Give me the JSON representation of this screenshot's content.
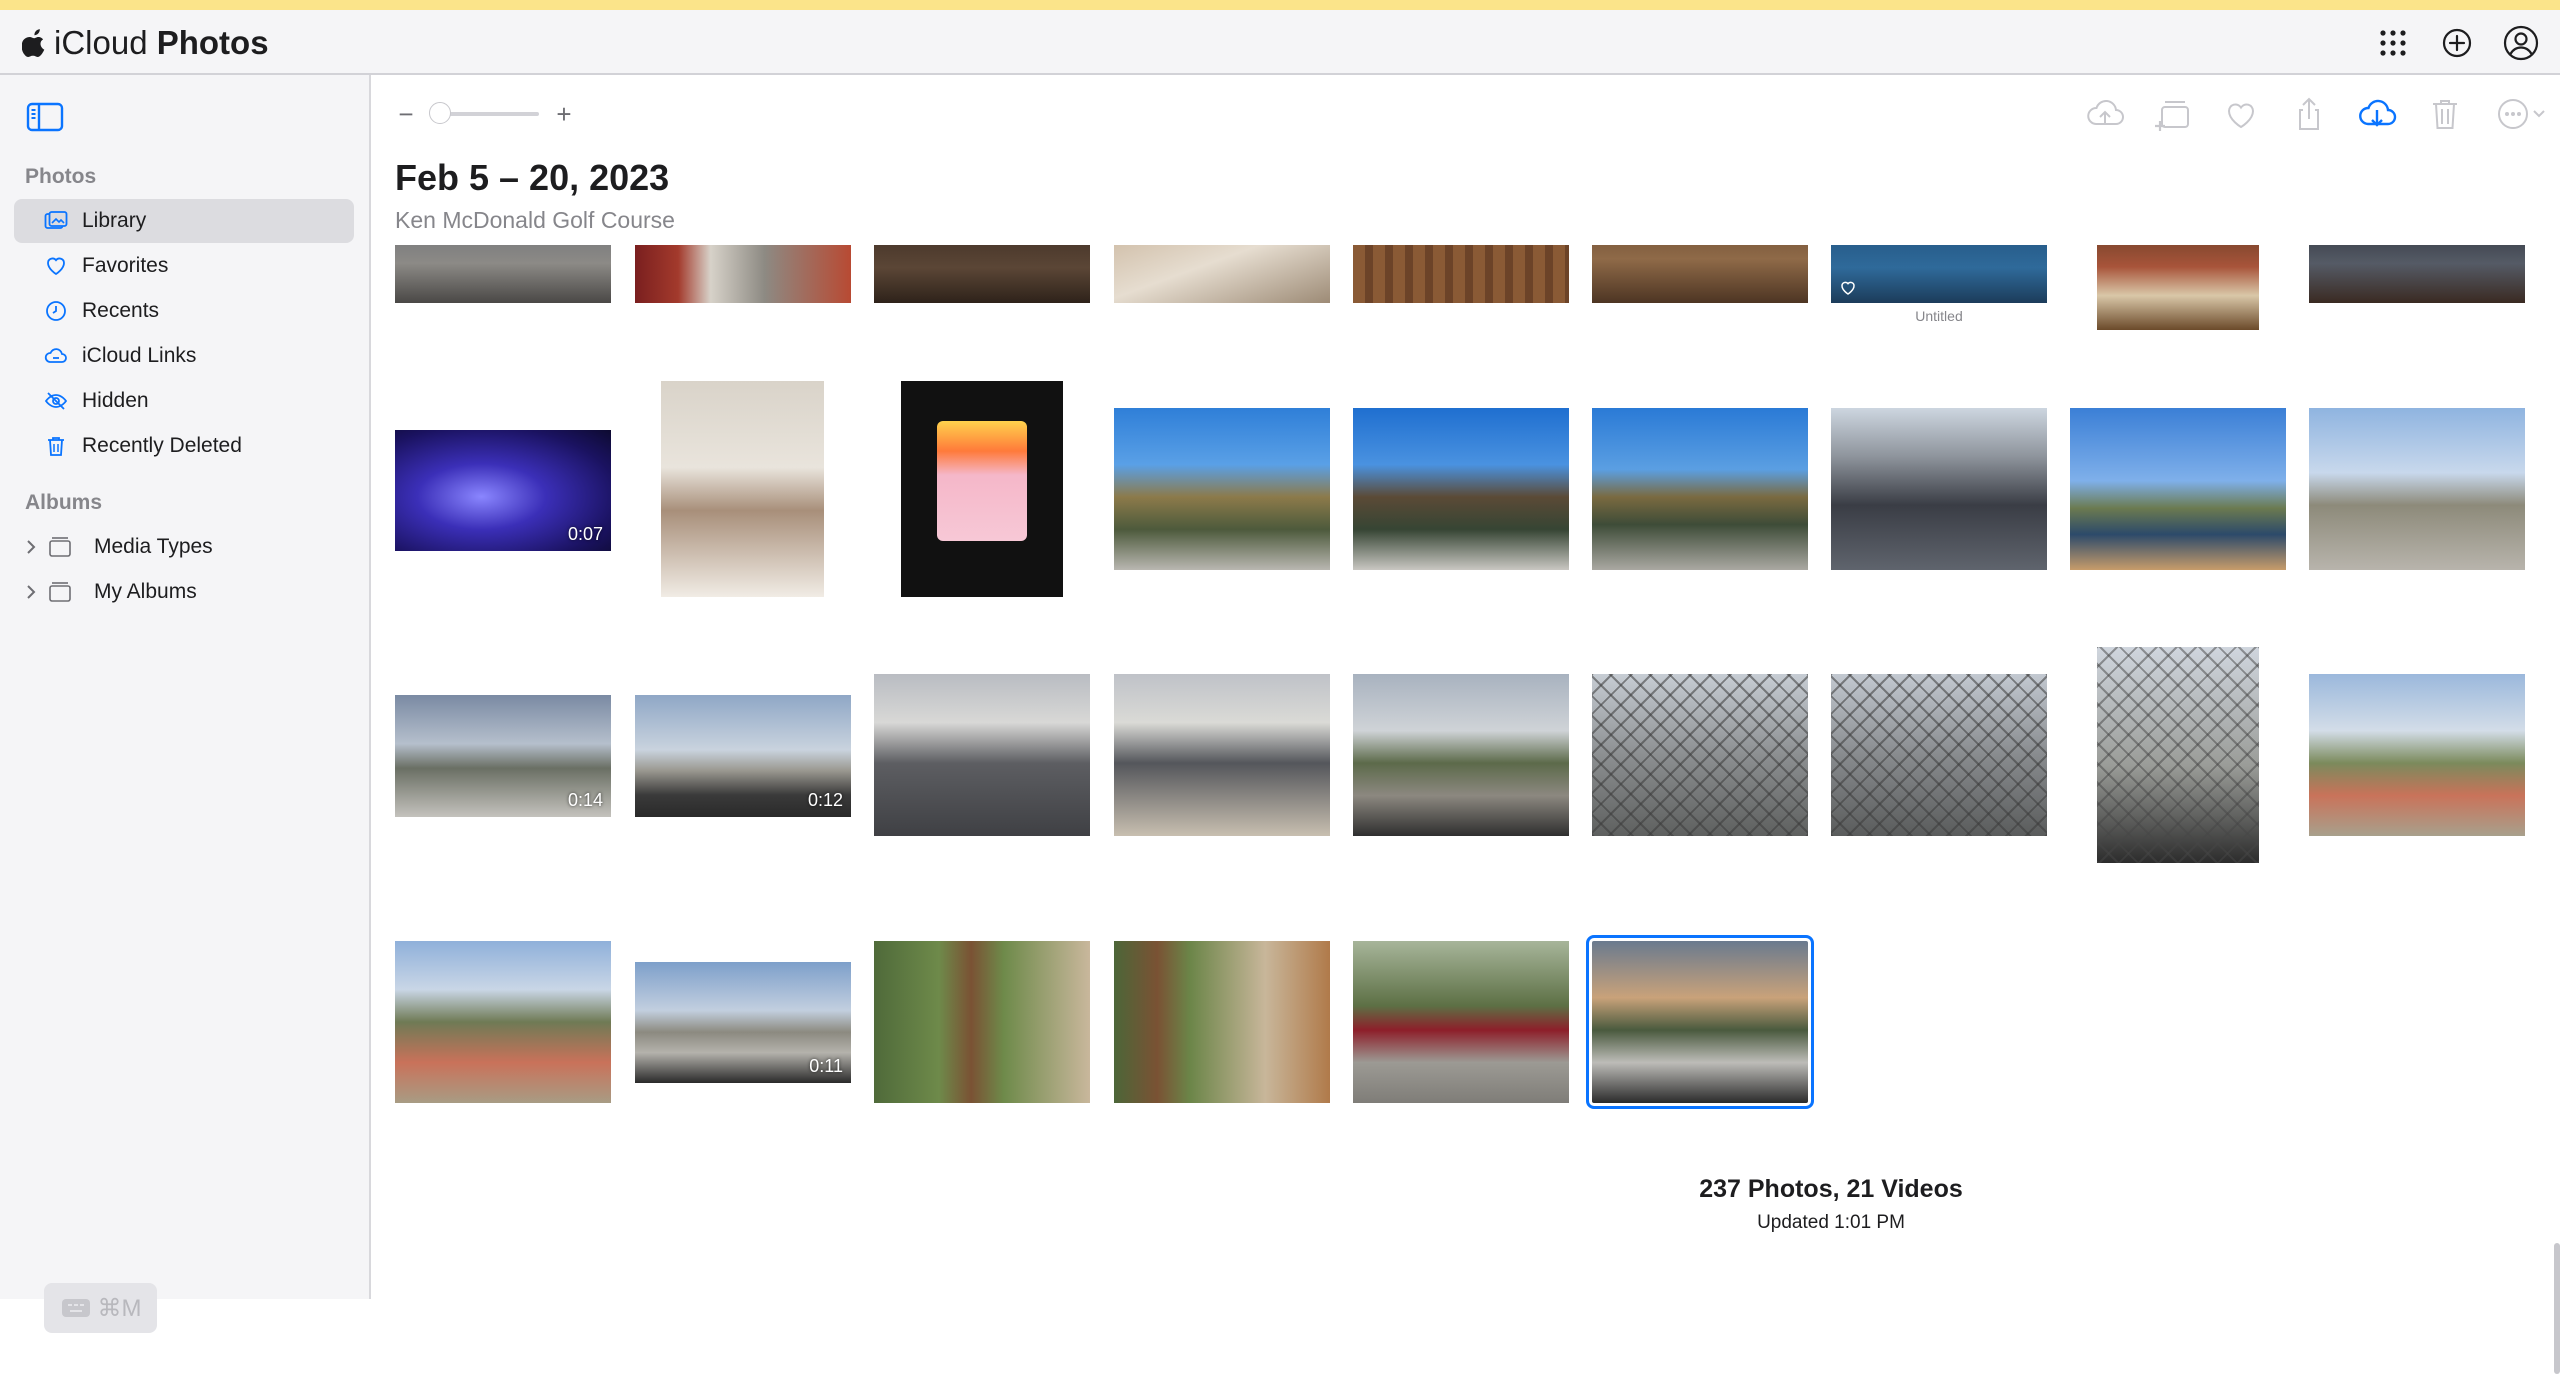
{
  "header": {
    "brand_prefix": "iCloud",
    "brand_name": "Photos",
    "icons": [
      "apps-grid-icon",
      "add-circle-icon",
      "account-icon"
    ]
  },
  "sidebar": {
    "photos_section": "Photos",
    "items": [
      {
        "label": "Library",
        "icon": "library-icon",
        "selected": true
      },
      {
        "label": "Favorites",
        "icon": "heart-icon",
        "selected": false
      },
      {
        "label": "Recents",
        "icon": "clock-icon",
        "selected": false
      },
      {
        "label": "iCloud Links",
        "icon": "cloud-link-icon",
        "selected": false
      },
      {
        "label": "Hidden",
        "icon": "eye-slash-icon",
        "selected": false
      },
      {
        "label": "Recently Deleted",
        "icon": "trash-icon",
        "selected": false
      }
    ],
    "albums_section": "Albums",
    "albums": [
      {
        "label": "Media Types",
        "icon": "folder-icon"
      },
      {
        "label": "My Albums",
        "icon": "folder-icon"
      }
    ],
    "shortcut_hint": "⌘M"
  },
  "main": {
    "zoom": {
      "minus": "−",
      "plus": "+",
      "level": 0.0
    },
    "toolbar_icons": [
      "upload-icon",
      "add-to-album-icon",
      "favorite-icon",
      "share-icon",
      "download-icon",
      "delete-icon",
      "more-icon"
    ],
    "title": "Feb 5 – 20, 2023",
    "subtitle": "Ken McDonald Golf Course",
    "untitled_caption": "Untitled",
    "durations": [
      "0:07",
      "0:14",
      "0:12",
      "0:11"
    ],
    "footer_counts": "237 Photos, 21 Videos",
    "footer_updated": "Updated 1:01 PM"
  },
  "colors": {
    "accent": "#0a74ff",
    "top_stripe": "#fbe48a",
    "sidebar_bg": "#f5f5f7",
    "selected_row": "#dcdce0"
  }
}
